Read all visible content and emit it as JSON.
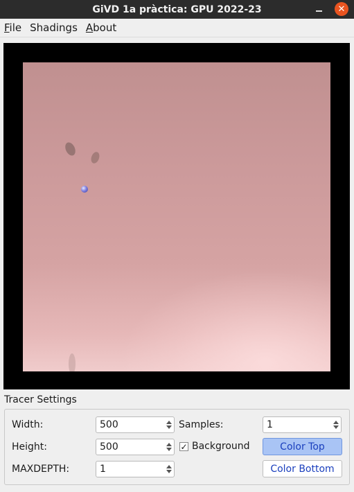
{
  "window": {
    "title": "GiVD 1a pràctica: GPU 2022-23"
  },
  "menu": [
    {
      "label": "File",
      "underline": "F"
    },
    {
      "label": "Shadings"
    },
    {
      "label": "About",
      "underline": "A"
    }
  ],
  "tracer": {
    "group_title": "Tracer Settings",
    "width_label": "Width:",
    "width_value": "500",
    "height_label": "Height:",
    "height_value": "500",
    "maxdepth_label": "MAXDEPTH:",
    "maxdepth_value": "1",
    "samples_label": "Samples:",
    "samples_value": "1",
    "background_label": "Background",
    "background_checked": true,
    "color_top_label": "Color Top",
    "color_bottom_label": "Color Bottom"
  },
  "colors": {
    "titlebar": "#2c2c2c",
    "close_button": "#e95420",
    "render_background_top": "#c09090",
    "render_background_bottom": "#f0cccc",
    "sphere": "#6a6acc",
    "button_text": "#1a3fbd"
  }
}
